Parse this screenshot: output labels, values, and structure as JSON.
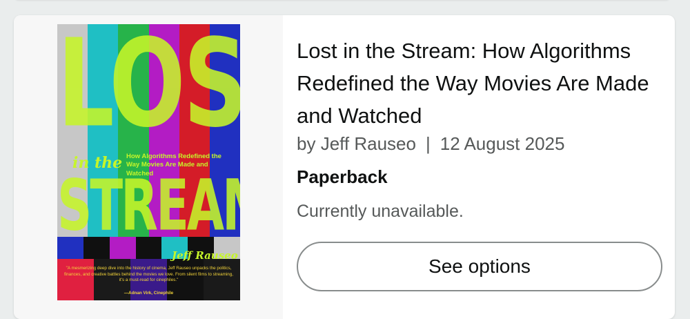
{
  "product": {
    "title": "Lost in the Stream: How Algorithms Redefined the Way Movies Are Made and Watched",
    "author_prefix": "by",
    "author": "Jeff Rauseo",
    "separator": "|",
    "date": "12 August 2025",
    "format": "Paperback",
    "availability": "Currently unavailable.",
    "cta_label": "See options"
  },
  "cover": {
    "word_top": "LOST",
    "word_mid": "in the",
    "word_bottom": "STREAM",
    "subtitle": "How Algorithms Redefined the Way Movies Are Made and Watched",
    "author_signature": "Jeff Rauseo",
    "blurb": "\"A mesmerizing deep dive into the history of cinema, Jeff Rauseo unpacks the politics, finances, and creative battles behind the movies we love. From silent films to streaming, it's a must-read for cinephiles.\"",
    "blurb_attribution": "—Adnan Virk, Cinephile",
    "bar_colors": [
      "#c7c7c7",
      "#1fbfc4",
      "#27b34a",
      "#b31cc4",
      "#d41c28",
      "#2030c0"
    ],
    "accent_color": "#c6f52a"
  },
  "colors": {
    "page_bg": "#eaeded",
    "card_bg": "#ffffff",
    "text_primary": "#0f1111",
    "text_secondary": "#565959",
    "button_border": "#888c8c"
  }
}
